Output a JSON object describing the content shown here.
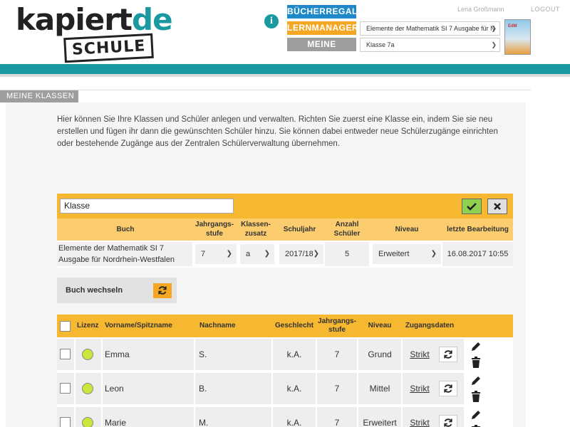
{
  "header": {
    "logo_text_a": "kapiert",
    "logo_text_b": "de",
    "logo_text_c": "SCHULE",
    "nav": {
      "buecherregal": "BÜCHERREGAL",
      "lernmanager": "LERNMANAGER",
      "meine_klassen": "MEINE KLASSEN"
    },
    "book_select": "Elemente der Mathematik SI 7 Ausgabe für N",
    "class_select": "Klasse 7a",
    "user_name": "Lena Großmann",
    "logout": "LOGOUT",
    "cover_label": "EdM"
  },
  "section": {
    "tab": "MEINE KLASSEN",
    "intro": "Hier können Sie Ihre Klassen und Schüler anlegen und verwalten. Richten Sie zuerst eine Klasse ein, indem Sie sie neu erstellen und fügen ihr dann die gewünschten Schüler hinzu. Sie können dabei entweder neue Schülerzugänge einrichten oder bestehende Zugänge aus der Zentralen Schülerverwaltung übernehmen."
  },
  "class_form": {
    "name_value": "Klasse",
    "headers": {
      "buch": "Buch",
      "jahrgang": "Jahrgangs-\nstufe",
      "zusatz": "Klassen-\nzusatz",
      "schuljahr": "Schuljahr",
      "anzahl": "Anzahl\nSchüler",
      "niveau": "Niveau",
      "bearbeitung": "letzte Bearbeitung"
    },
    "row": {
      "buch": "Elemente der Mathematik SI 7 Ausgabe für Nordrhein-Westfalen",
      "jahrgang": "7",
      "zusatz": "a",
      "schuljahr": "2017/18",
      "anzahl": "5",
      "niveau": "Erweitert",
      "bearbeitung": "16.08.2017 10:55"
    },
    "swap_label": "Buch wechseln"
  },
  "students": {
    "headers": {
      "lizenz": "Lizenz",
      "vorname": "Vorname/Spitzname",
      "nachname": "Nachname",
      "geschlecht": "Geschlecht",
      "jahrgang": "Jahrgangs-\nstufe",
      "niveau": "Niveau",
      "zugang": "Zugangsdaten"
    },
    "rows": [
      {
        "vorname": "Emma",
        "nachname": "S.",
        "geschlecht": "k.A.",
        "jahrgang": "7",
        "niveau": "Grund",
        "zugang": "Strikt"
      },
      {
        "vorname": "Leon",
        "nachname": "B.",
        "geschlecht": "k.A.",
        "jahrgang": "7",
        "niveau": "Mittel",
        "zugang": "Strikt"
      },
      {
        "vorname": "Marie",
        "nachname": "M.",
        "geschlecht": "k.A.",
        "jahrgang": "7",
        "niveau": "Erweitert",
        "zugang": "Strikt"
      }
    ]
  },
  "colors": {
    "teal": "#1a9aa0",
    "orange": "#f6b731",
    "blue": "#1e88c8",
    "green_ok": "#8fd14f",
    "license_dot": "#c8e63c"
  }
}
